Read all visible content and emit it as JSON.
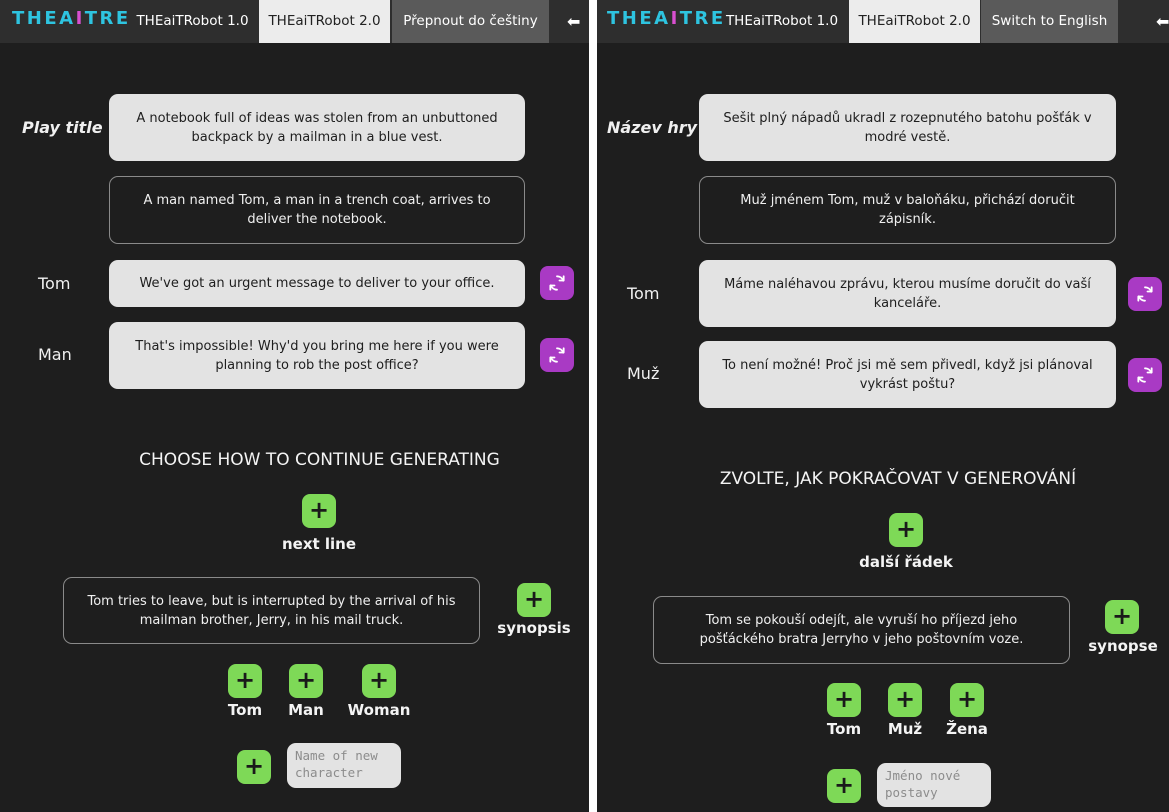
{
  "colors": {
    "background": "#1e1e1e",
    "topbar": "#2e2e2e",
    "bubble_light": "#e3e3e3",
    "regen_button": "#a93ac4",
    "add_button": "#7ed957",
    "logo_gradient": [
      "#2ec4e0",
      "#d94fd0"
    ]
  },
  "left": {
    "logo": "THEAITRE",
    "tabs": [
      "THEaiTRobot 1.0",
      "THEaiTRobot 2.0"
    ],
    "language_button": "Přepnout do češtiny",
    "back_icon": "arrow-left-icon",
    "play_title_label": "Play title",
    "play_title": "A notebook full of ideas was stolen from an unbuttoned backpack by a mailman in a blue vest.",
    "scene_description": "A man named Tom, a man in a trench coat, arrives to deliver the notebook.",
    "lines": [
      {
        "speaker": "Tom",
        "text": "We've got an urgent message to deliver to your office."
      },
      {
        "speaker": "Man",
        "text": "That's impossible! Why'd you bring me here if you were planning to rob the post office?"
      }
    ],
    "continue_heading": "CHOOSE HOW TO CONTINUE GENERATING",
    "next_line_label": "next line",
    "synopsis_text": "Tom tries to leave, but is interrupted by the arrival of his mailman brother, Jerry, in his mail truck.",
    "synopsis_label": "synopsis",
    "characters": [
      "Tom",
      "Man",
      "Woman"
    ],
    "new_character_placeholder": "Name of new character"
  },
  "right": {
    "logo": "THEAITRE",
    "tabs": [
      "THEaiTRobot 1.0",
      "THEaiTRobot 2.0"
    ],
    "language_button": "Switch to English",
    "back_icon": "arrow-left-icon",
    "play_title_label": "Název hry",
    "play_title": "Sešit plný nápadů ukradl z rozepnutého batohu pošťák v modré vestě.",
    "scene_description": "Muž jménem Tom, muž v baloňáku, přichází doručit zápisník.",
    "lines": [
      {
        "speaker": "Tom",
        "text": "Máme naléhavou zprávu, kterou musíme doručit do vaší kanceláře."
      },
      {
        "speaker": "Muž",
        "text": "To není možné! Proč jsi mě sem přivedl, když jsi plánoval vykrást poštu?"
      }
    ],
    "continue_heading": "ZVOLTE, JAK POKRAČOVAT V GENEROVÁNÍ",
    "next_line_label": "další řádek",
    "synopsis_text": "Tom se pokouší odejít, ale vyruší ho příjezd jeho pošťáckého bratra Jerryho v jeho poštovním voze.",
    "synopsis_label": "synopse",
    "characters": [
      "Tom",
      "Muž",
      "Žena"
    ],
    "new_character_placeholder": "Jméno nové postavy"
  }
}
